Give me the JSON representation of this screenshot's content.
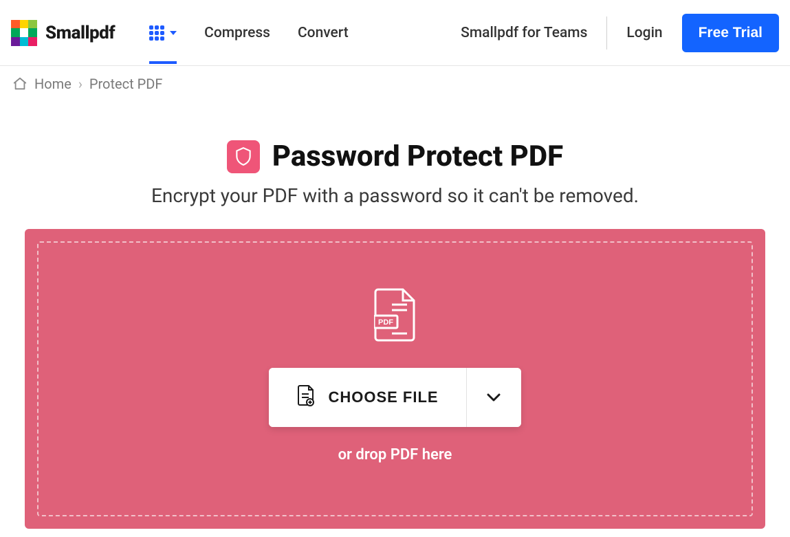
{
  "header": {
    "brand": "Smallpdf",
    "nav": {
      "compress": "Compress",
      "convert": "Convert",
      "teams": "Smallpdf for Teams",
      "login": "Login",
      "free_trial": "Free Trial"
    }
  },
  "breadcrumb": {
    "home": "Home",
    "sep": "›",
    "current": "Protect PDF"
  },
  "hero": {
    "title": "Password Protect PDF",
    "subtitle": "Encrypt your PDF with a password so it can't be removed."
  },
  "dropzone": {
    "choose_label": "CHOOSE FILE",
    "drop_text": "or drop PDF here",
    "pdf_badge": "PDF"
  },
  "colors": {
    "primary_blue": "#1364ff",
    "drop_bg": "#df6179",
    "shield_bg": "#ef5578"
  }
}
